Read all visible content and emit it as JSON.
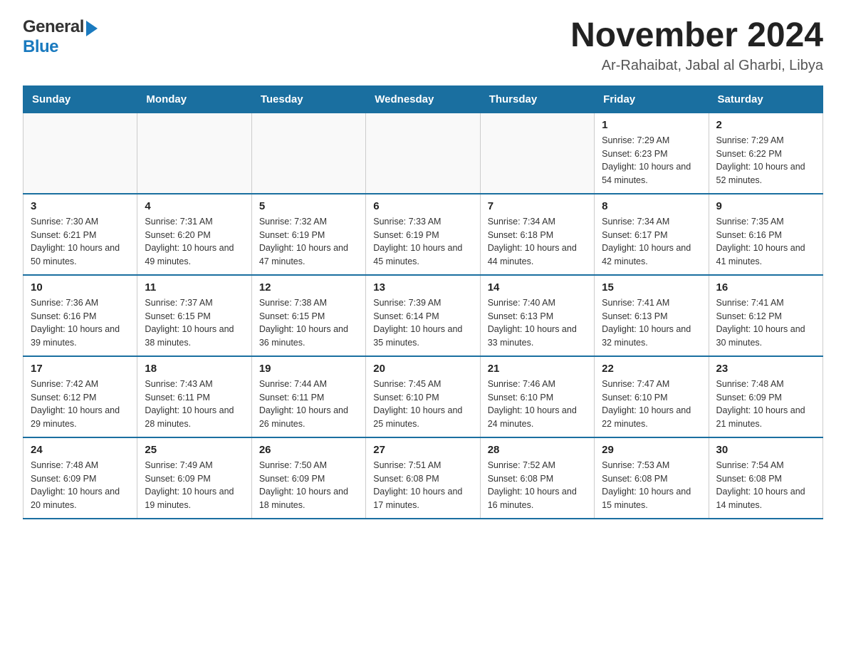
{
  "header": {
    "logo_line1": "General",
    "logo_line2": "Blue",
    "title": "November 2024",
    "subtitle": "Ar-Rahaibat, Jabal al Gharbi, Libya"
  },
  "calendar": {
    "days_of_week": [
      "Sunday",
      "Monday",
      "Tuesday",
      "Wednesday",
      "Thursday",
      "Friday",
      "Saturday"
    ],
    "weeks": [
      [
        {
          "day": "",
          "info": ""
        },
        {
          "day": "",
          "info": ""
        },
        {
          "day": "",
          "info": ""
        },
        {
          "day": "",
          "info": ""
        },
        {
          "day": "",
          "info": ""
        },
        {
          "day": "1",
          "info": "Sunrise: 7:29 AM\nSunset: 6:23 PM\nDaylight: 10 hours and 54 minutes."
        },
        {
          "day": "2",
          "info": "Sunrise: 7:29 AM\nSunset: 6:22 PM\nDaylight: 10 hours and 52 minutes."
        }
      ],
      [
        {
          "day": "3",
          "info": "Sunrise: 7:30 AM\nSunset: 6:21 PM\nDaylight: 10 hours and 50 minutes."
        },
        {
          "day": "4",
          "info": "Sunrise: 7:31 AM\nSunset: 6:20 PM\nDaylight: 10 hours and 49 minutes."
        },
        {
          "day": "5",
          "info": "Sunrise: 7:32 AM\nSunset: 6:19 PM\nDaylight: 10 hours and 47 minutes."
        },
        {
          "day": "6",
          "info": "Sunrise: 7:33 AM\nSunset: 6:19 PM\nDaylight: 10 hours and 45 minutes."
        },
        {
          "day": "7",
          "info": "Sunrise: 7:34 AM\nSunset: 6:18 PM\nDaylight: 10 hours and 44 minutes."
        },
        {
          "day": "8",
          "info": "Sunrise: 7:34 AM\nSunset: 6:17 PM\nDaylight: 10 hours and 42 minutes."
        },
        {
          "day": "9",
          "info": "Sunrise: 7:35 AM\nSunset: 6:16 PM\nDaylight: 10 hours and 41 minutes."
        }
      ],
      [
        {
          "day": "10",
          "info": "Sunrise: 7:36 AM\nSunset: 6:16 PM\nDaylight: 10 hours and 39 minutes."
        },
        {
          "day": "11",
          "info": "Sunrise: 7:37 AM\nSunset: 6:15 PM\nDaylight: 10 hours and 38 minutes."
        },
        {
          "day": "12",
          "info": "Sunrise: 7:38 AM\nSunset: 6:15 PM\nDaylight: 10 hours and 36 minutes."
        },
        {
          "day": "13",
          "info": "Sunrise: 7:39 AM\nSunset: 6:14 PM\nDaylight: 10 hours and 35 minutes."
        },
        {
          "day": "14",
          "info": "Sunrise: 7:40 AM\nSunset: 6:13 PM\nDaylight: 10 hours and 33 minutes."
        },
        {
          "day": "15",
          "info": "Sunrise: 7:41 AM\nSunset: 6:13 PM\nDaylight: 10 hours and 32 minutes."
        },
        {
          "day": "16",
          "info": "Sunrise: 7:41 AM\nSunset: 6:12 PM\nDaylight: 10 hours and 30 minutes."
        }
      ],
      [
        {
          "day": "17",
          "info": "Sunrise: 7:42 AM\nSunset: 6:12 PM\nDaylight: 10 hours and 29 minutes."
        },
        {
          "day": "18",
          "info": "Sunrise: 7:43 AM\nSunset: 6:11 PM\nDaylight: 10 hours and 28 minutes."
        },
        {
          "day": "19",
          "info": "Sunrise: 7:44 AM\nSunset: 6:11 PM\nDaylight: 10 hours and 26 minutes."
        },
        {
          "day": "20",
          "info": "Sunrise: 7:45 AM\nSunset: 6:10 PM\nDaylight: 10 hours and 25 minutes."
        },
        {
          "day": "21",
          "info": "Sunrise: 7:46 AM\nSunset: 6:10 PM\nDaylight: 10 hours and 24 minutes."
        },
        {
          "day": "22",
          "info": "Sunrise: 7:47 AM\nSunset: 6:10 PM\nDaylight: 10 hours and 22 minutes."
        },
        {
          "day": "23",
          "info": "Sunrise: 7:48 AM\nSunset: 6:09 PM\nDaylight: 10 hours and 21 minutes."
        }
      ],
      [
        {
          "day": "24",
          "info": "Sunrise: 7:48 AM\nSunset: 6:09 PM\nDaylight: 10 hours and 20 minutes."
        },
        {
          "day": "25",
          "info": "Sunrise: 7:49 AM\nSunset: 6:09 PM\nDaylight: 10 hours and 19 minutes."
        },
        {
          "day": "26",
          "info": "Sunrise: 7:50 AM\nSunset: 6:09 PM\nDaylight: 10 hours and 18 minutes."
        },
        {
          "day": "27",
          "info": "Sunrise: 7:51 AM\nSunset: 6:08 PM\nDaylight: 10 hours and 17 minutes."
        },
        {
          "day": "28",
          "info": "Sunrise: 7:52 AM\nSunset: 6:08 PM\nDaylight: 10 hours and 16 minutes."
        },
        {
          "day": "29",
          "info": "Sunrise: 7:53 AM\nSunset: 6:08 PM\nDaylight: 10 hours and 15 minutes."
        },
        {
          "day": "30",
          "info": "Sunrise: 7:54 AM\nSunset: 6:08 PM\nDaylight: 10 hours and 14 minutes."
        }
      ]
    ]
  }
}
